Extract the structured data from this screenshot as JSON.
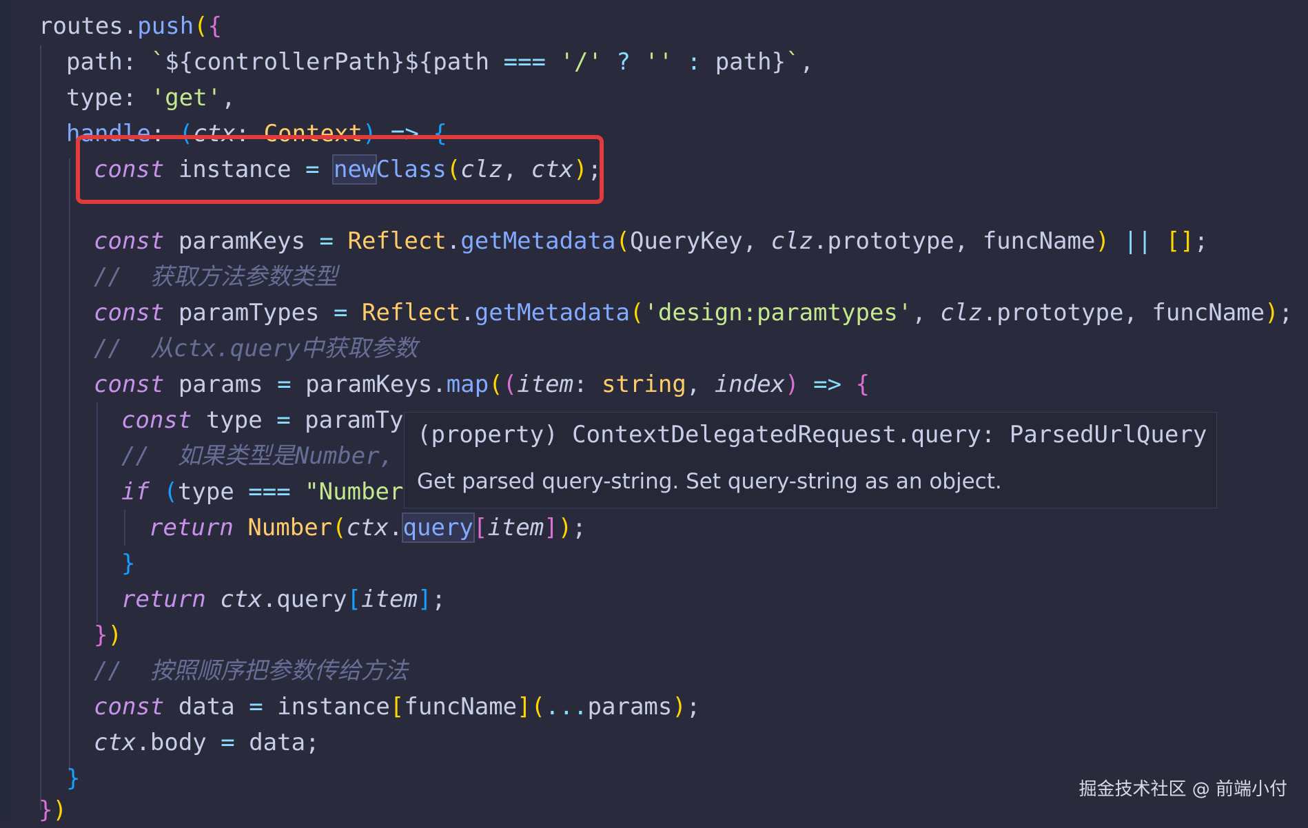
{
  "code": {
    "line_routes_push": "routes.push({",
    "line_path": "path: `${controllerPath}${path === '/' ? '' : path}`,",
    "line_type": "type: 'get',",
    "line_handle": "handle: (ctx: Context) => {",
    "line_instance": "const instance = newClass(clz, ctx);",
    "line_paramkeys": "const paramKeys = Reflect.getMetadata(QueryKey, clz.prototype, funcName) || [];",
    "comment_get_param_types": "//  获取方法参数类型",
    "line_paramtypes": "const paramTypes = Reflect.getMetadata('design:paramtypes', clz.prototype, funcName);",
    "comment_from_query": "//  从ctx.query中获取参数",
    "line_params": "const params = paramKeys.map((item: string, index) => {",
    "line_const_type": "const type = paramTy",
    "comment_if_number": "//  如果类型是Number, 贝",
    "line_if": "if (type === \"Number",
    "line_return_number": "return Number(ctx.query[item]);",
    "line_close_if": "}",
    "line_return_query": "return ctx.query[item];",
    "line_close_map": "})",
    "comment_pass_params": "//  按照顺序把参数传给方法",
    "line_data": "const data = instance[funcName](...params);",
    "line_body": "ctx.body = data;",
    "line_close_handle": "}",
    "line_close_push": "})"
  },
  "tooltip": {
    "signature": "(property) ContextDelegatedRequest.query: ParsedUrlQuery",
    "doc": "Get parsed query-string. Set query-string as an object."
  },
  "watermark": "掘金技术社区 @ 前端小付",
  "colors": {
    "background": "#292b3d",
    "highlight_box": "#e03c3c",
    "keyword": "#c792ea",
    "function": "#82aaff",
    "class": "#ffcb6b",
    "string": "#c3e88d",
    "comment": "#676e95"
  }
}
